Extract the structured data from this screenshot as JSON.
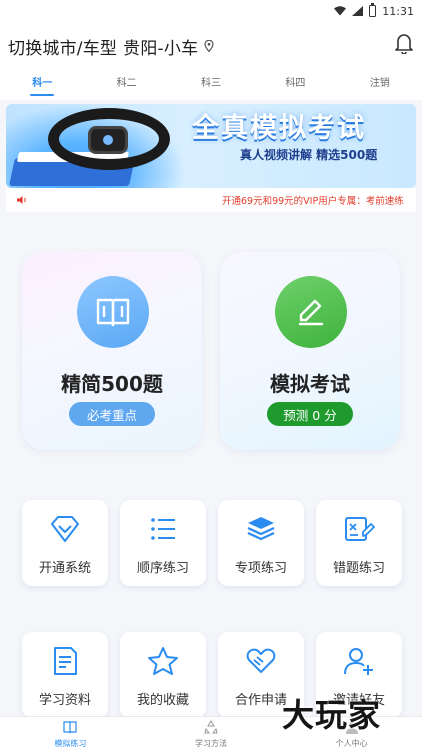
{
  "status_bar": {
    "time": "11:31"
  },
  "header": {
    "title": "切换城市/车型",
    "city": "贵阳-小车"
  },
  "tabs": [
    {
      "label": "科一",
      "active": true
    },
    {
      "label": "科二",
      "active": false
    },
    {
      "label": "科三",
      "active": false
    },
    {
      "label": "科四",
      "active": false
    },
    {
      "label": "注销",
      "active": false
    }
  ],
  "banner": {
    "title": "全真模拟考试",
    "subtitle": "真人视频讲解 精选500题"
  },
  "notice": {
    "text": "开通69元和99元的VIP用户专属：考前速练"
  },
  "cards": [
    {
      "title": "精简500题",
      "badge": "必考重点",
      "icon": "book-icon",
      "color": "#5fa8f0"
    },
    {
      "title": "模拟考试",
      "badge": "预测 0 分",
      "icon": "pencil-icon",
      "color": "#1f9b2e"
    }
  ],
  "tiles": [
    {
      "label": "开通系统",
      "icon": "diamond-icon"
    },
    {
      "label": "顺序练习",
      "icon": "list-icon"
    },
    {
      "label": "专项练习",
      "icon": "layers-icon"
    },
    {
      "label": "错题练习",
      "icon": "exam-edit-icon"
    },
    {
      "label": "学习资料",
      "icon": "document-icon"
    },
    {
      "label": "我的收藏",
      "icon": "star-icon"
    },
    {
      "label": "合作申请",
      "icon": "handshake-icon"
    },
    {
      "label": "邀请好友",
      "icon": "add-user-icon"
    }
  ],
  "bottom_nav": [
    {
      "label": "模拟练习",
      "active": true
    },
    {
      "label": "学习方法",
      "active": false
    },
    {
      "label": "个人中心",
      "active": false
    }
  ],
  "watermark": "大玩家",
  "colors": {
    "accent": "#2b8cf0",
    "green": "#1f9b2e",
    "notice_red": "#e23b2b"
  }
}
